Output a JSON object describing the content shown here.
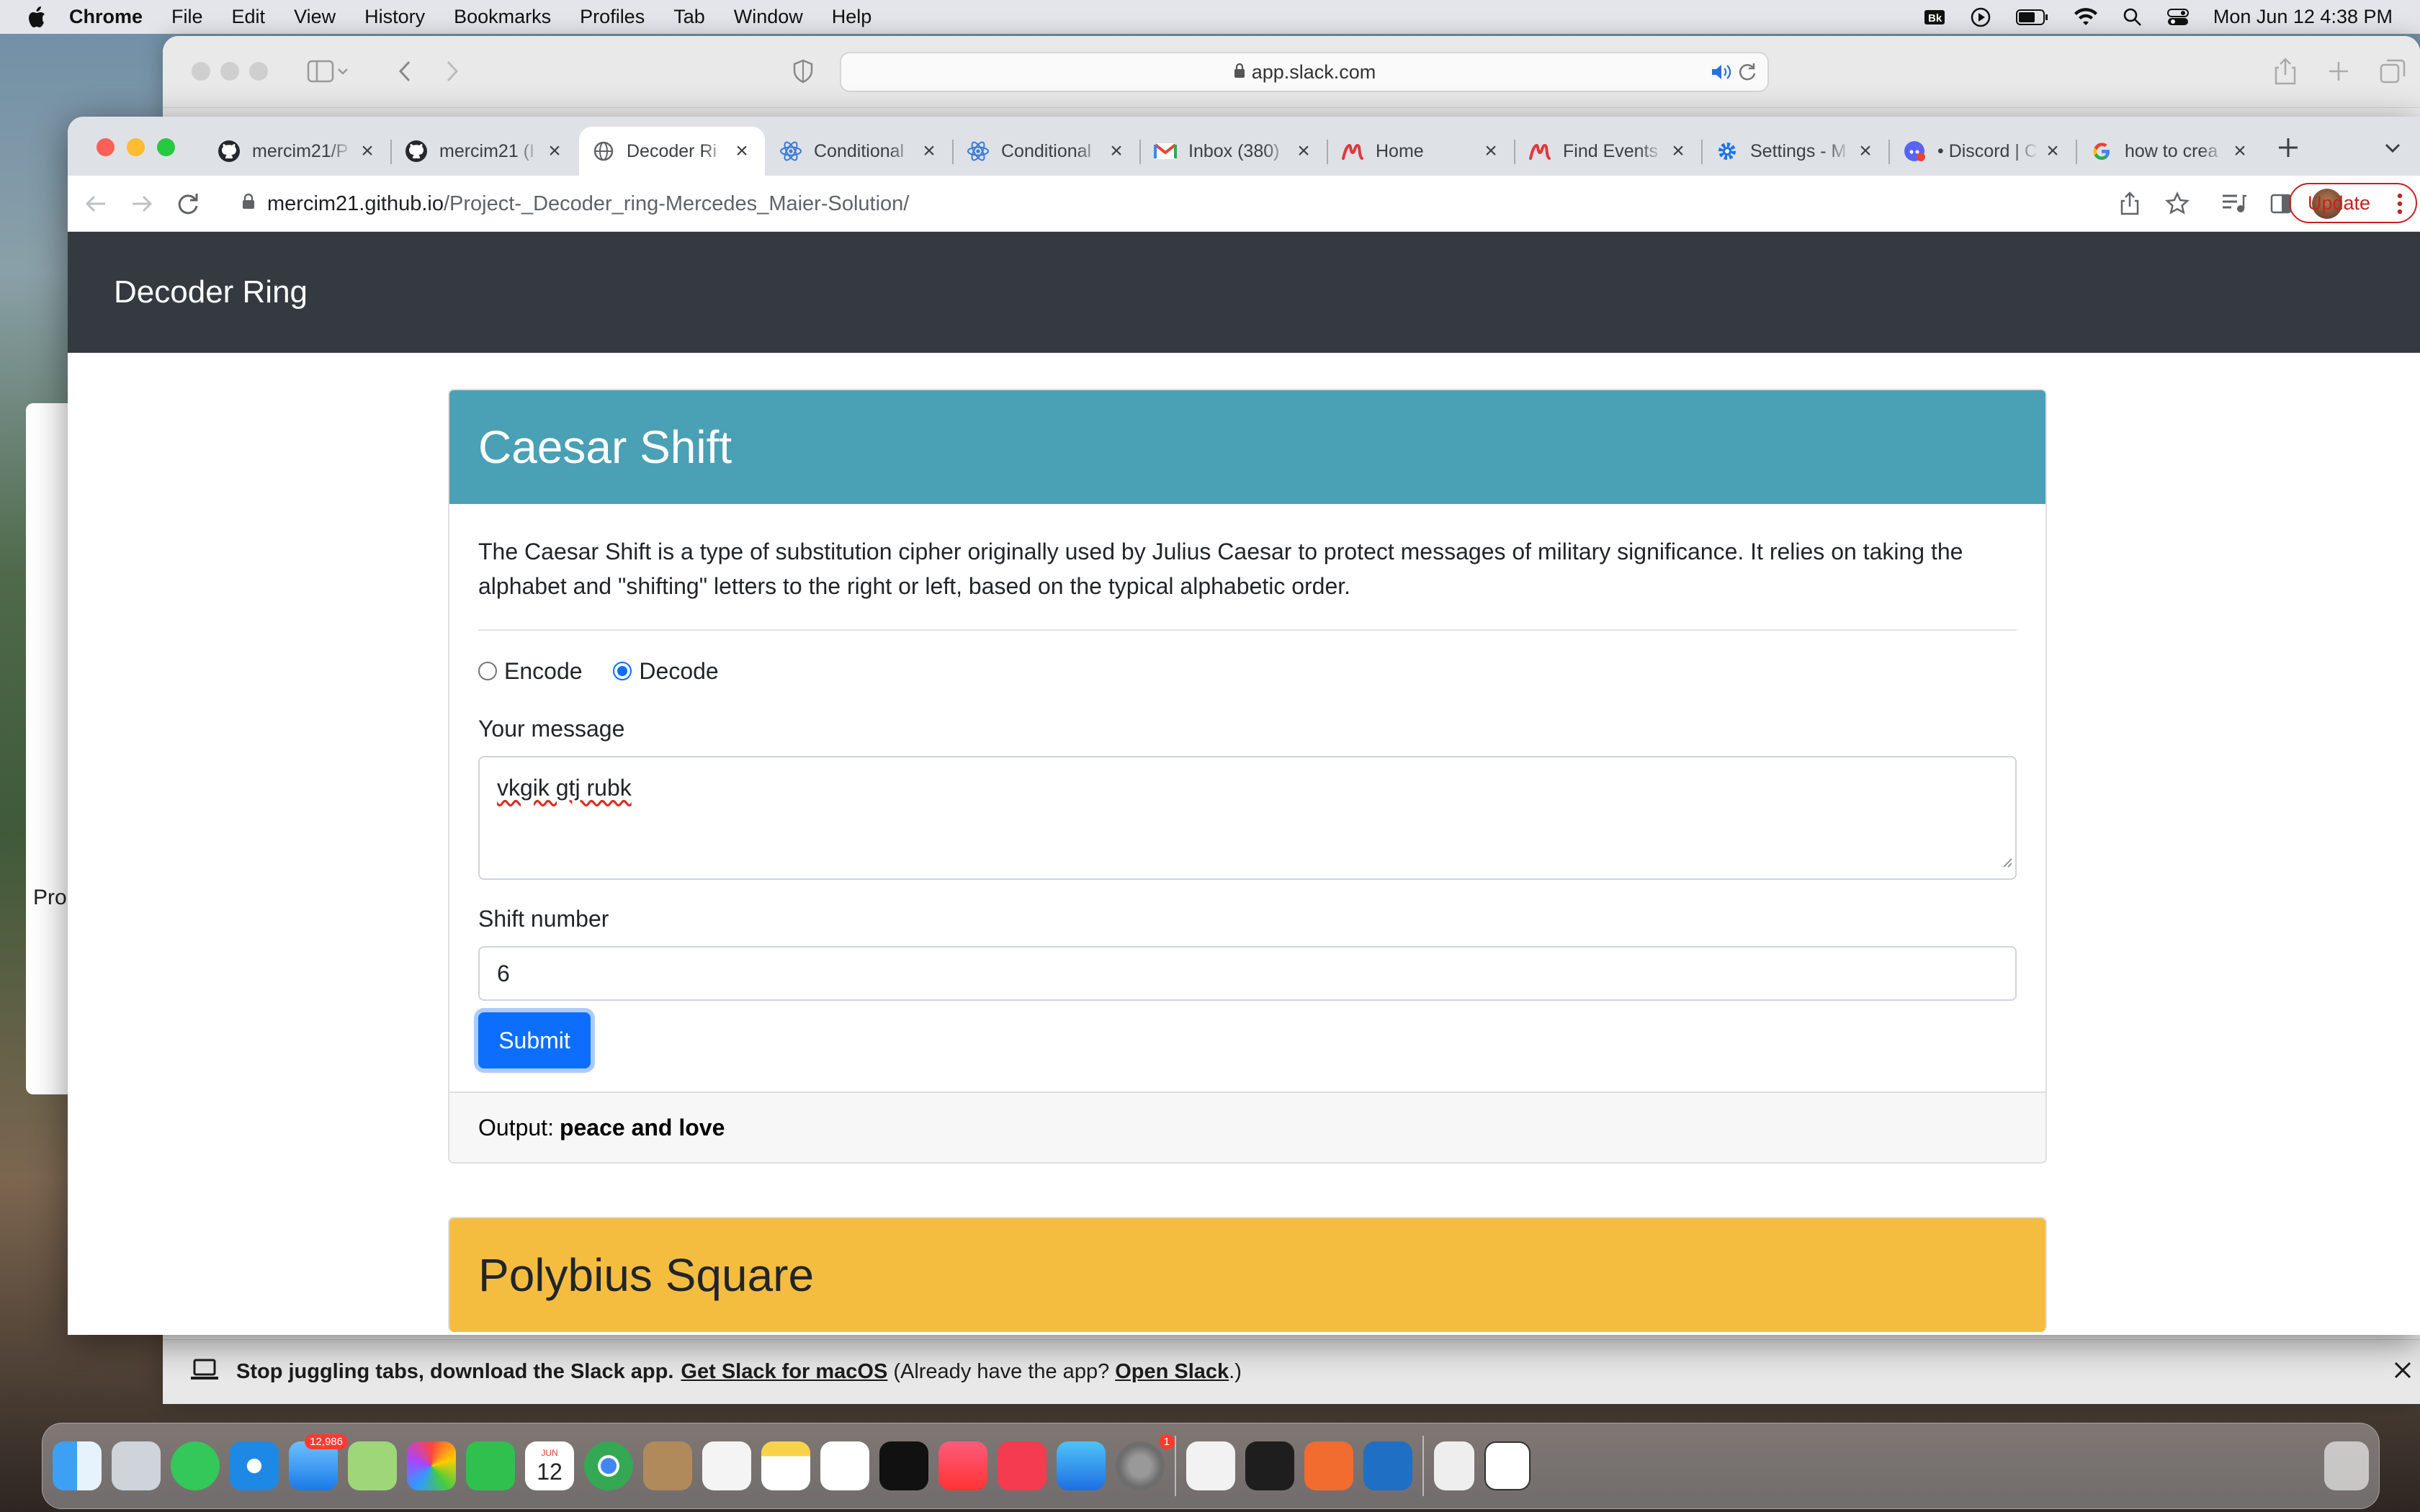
{
  "menubar": {
    "items": [
      "Chrome",
      "File",
      "Edit",
      "View",
      "History",
      "Bookmarks",
      "Profiles",
      "Tab",
      "Window",
      "Help"
    ],
    "clock": "Mon Jun 12  4:38 PM"
  },
  "slack_window": {
    "url": "app.slack.com",
    "banner": {
      "text": "Stop juggling tabs, download the Slack app.",
      "link1": "Get Slack for macOS",
      "mid": "(Already have the app?",
      "link2": "Open Slack",
      "end": ".)"
    }
  },
  "left_doc": {
    "text": "Pro"
  },
  "tabs": [
    {
      "title": "mercim21/P",
      "icon": "github-icon"
    },
    {
      "title": "mercim21 (I",
      "icon": "github-icon"
    },
    {
      "title": "Decoder Ri",
      "icon": "globe-icon",
      "active": true
    },
    {
      "title": "Conditional",
      "icon": "react-icon"
    },
    {
      "title": "Conditional",
      "icon": "react-icon"
    },
    {
      "title": "Inbox (380)",
      "icon": "gmail-icon"
    },
    {
      "title": "Home",
      "icon": "meetup-icon"
    },
    {
      "title": "Find Events",
      "icon": "meetup-icon"
    },
    {
      "title": "Settings - M",
      "icon": "gear-icon"
    },
    {
      "title": "• Discord | C",
      "icon": "discord-icon"
    },
    {
      "title": "how to crea",
      "icon": "google-icon"
    }
  ],
  "address": {
    "host": "mercim21.github.io",
    "path": "/Project-_Decoder_ring-Mercedes_Maier-Solution/"
  },
  "update_label": "Update",
  "page": {
    "brand": "Decoder Ring",
    "caesar": {
      "title": "Caesar Shift",
      "description": "The Caesar Shift is a type of substitution cipher originally used by Julius Caesar to protect messages of military significance. It relies on taking the alphabet and \"shifting\" letters to the right or left, based on the typical alphabetic order.",
      "encode_label": "Encode",
      "decode_label": "Decode",
      "mode_selected": "Decode",
      "message_label": "Your message",
      "message_value": "vkgik gtj rubk",
      "shift_label": "Shift number",
      "shift_value": "6",
      "submit_label": "Submit",
      "output_label": "Output:",
      "output_value": "peace and love"
    },
    "polybius": {
      "title": "Polybius Square"
    }
  },
  "colors": {
    "caesar_header": "#4aa0b5",
    "polybius_header": "#f5bd40",
    "navbar": "#343a40",
    "primary": "#0d6efd"
  },
  "dock": {
    "mail_badge": "12,986",
    "calendar_month": "JUN",
    "calendar_day": "12",
    "settings_badge": "1"
  }
}
